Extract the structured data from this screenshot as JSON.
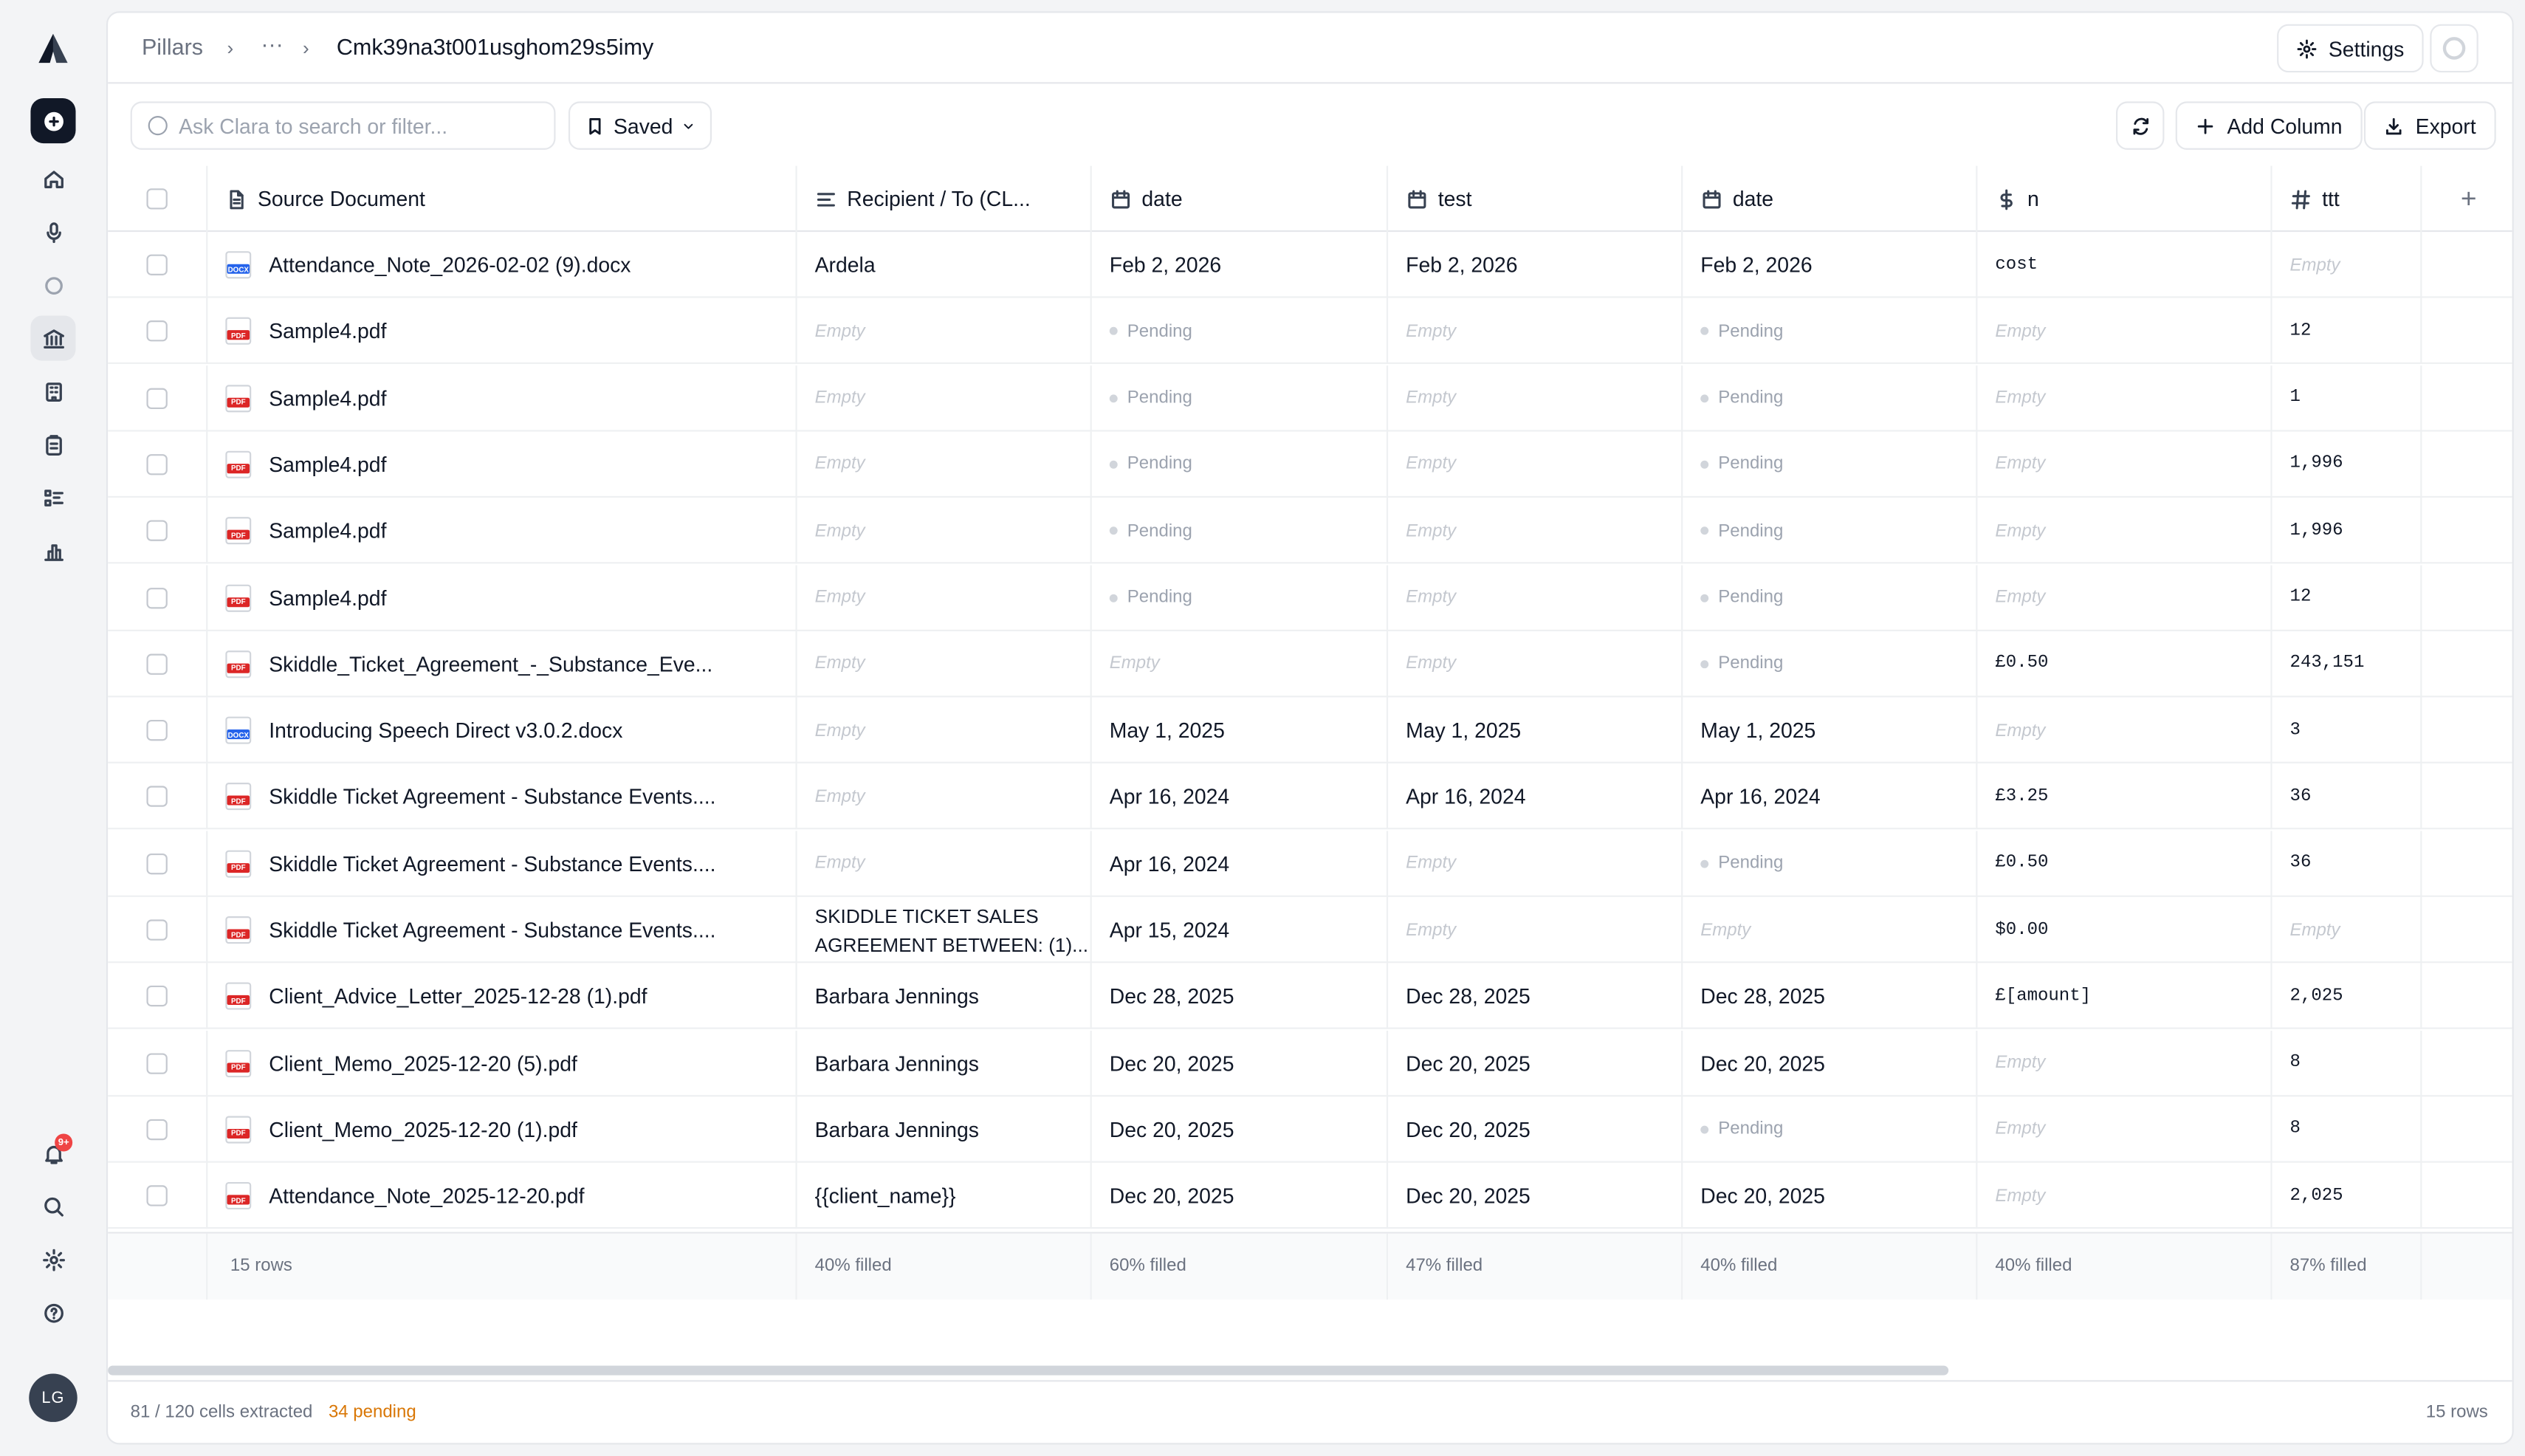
{
  "breadcrumb": {
    "root": "Pillars",
    "ellipsis": "···",
    "current": "Cmk39na3t001usghom29s5imy"
  },
  "header": {
    "settings_label": "Settings"
  },
  "toolbar": {
    "search_placeholder": "Ask Clara to search or filter...",
    "saved_label": "Saved",
    "add_column_label": "Add Column",
    "export_label": "Export"
  },
  "notifications": {
    "badge": "9+"
  },
  "user": {
    "initials": "LG"
  },
  "columns": [
    {
      "label": "Source Document",
      "icon": "document-icon"
    },
    {
      "label": "Recipient / To (CL...",
      "icon": "text-icon"
    },
    {
      "label": "date",
      "icon": "calendar-icon"
    },
    {
      "label": "test",
      "icon": "calendar-icon"
    },
    {
      "label": "date",
      "icon": "calendar-icon"
    },
    {
      "label": "n",
      "icon": "dollar-icon"
    },
    {
      "label": "ttt",
      "icon": "hash-icon"
    }
  ],
  "rows": [
    {
      "doc": "Attendance_Note_2026-02-02 (9).docx",
      "type": "docx",
      "recipient": "Ardela",
      "date1": "Feb 2, 2026",
      "test": "Feb 2, 2026",
      "date2": "Feb 2, 2026",
      "n": "cost",
      "ttt": "Empty"
    },
    {
      "doc": "Sample4.pdf",
      "type": "pdf",
      "recipient": "Empty",
      "date1": "Pending",
      "test": "Empty",
      "date2": "Pending",
      "n": "Empty",
      "ttt": "12"
    },
    {
      "doc": "Sample4.pdf",
      "type": "pdf",
      "recipient": "Empty",
      "date1": "Pending",
      "test": "Empty",
      "date2": "Pending",
      "n": "Empty",
      "ttt": "1"
    },
    {
      "doc": "Sample4.pdf",
      "type": "pdf",
      "recipient": "Empty",
      "date1": "Pending",
      "test": "Empty",
      "date2": "Pending",
      "n": "Empty",
      "ttt": "1,996"
    },
    {
      "doc": "Sample4.pdf",
      "type": "pdf",
      "recipient": "Empty",
      "date1": "Pending",
      "test": "Empty",
      "date2": "Pending",
      "n": "Empty",
      "ttt": "1,996"
    },
    {
      "doc": "Sample4.pdf",
      "type": "pdf",
      "recipient": "Empty",
      "date1": "Pending",
      "test": "Empty",
      "date2": "Pending",
      "n": "Empty",
      "ttt": "12"
    },
    {
      "doc": "Skiddle_Ticket_Agreement_-_Substance_Eve...",
      "type": "pdf",
      "recipient": "Empty",
      "date1": "Empty",
      "test": "Empty",
      "date2": "Pending",
      "n": "£0.50",
      "ttt": "243,151"
    },
    {
      "doc": "Introducing Speech Direct v3.0.2.docx",
      "type": "docx",
      "recipient": "Empty",
      "date1": "May 1, 2025",
      "test": "May 1, 2025",
      "date2": "May 1, 2025",
      "n": "Empty",
      "ttt": "3"
    },
    {
      "doc": "Skiddle Ticket Agreement - Substance Events....",
      "type": "pdf",
      "recipient": "Empty",
      "date1": "Apr 16, 2024",
      "test": "Apr 16, 2024",
      "date2": "Apr 16, 2024",
      "n": "£3.25",
      "ttt": "36"
    },
    {
      "doc": "Skiddle Ticket Agreement - Substance Events....",
      "type": "pdf",
      "recipient": "Empty",
      "date1": "Apr 16, 2024",
      "test": "Empty",
      "date2": "Pending",
      "n": "£0.50",
      "ttt": "36"
    },
    {
      "doc": "Skiddle Ticket Agreement - Substance Events....",
      "type": "pdf",
      "recipient": "SKIDDLE TICKET SALES AGREEMENT BETWEEN: (1)...",
      "date1": "Apr 15, 2024",
      "test": "Empty",
      "date2": "Empty",
      "n": "$0.00",
      "ttt": "Empty"
    },
    {
      "doc": "Client_Advice_Letter_2025-12-28 (1).pdf",
      "type": "pdf",
      "recipient": "Barbara Jennings",
      "date1": "Dec 28, 2025",
      "test": "Dec 28, 2025",
      "date2": "Dec 28, 2025",
      "n": "£[amount]",
      "ttt": "2,025"
    },
    {
      "doc": "Client_Memo_2025-12-20 (5).pdf",
      "type": "pdf",
      "recipient": "Barbara Jennings",
      "date1": "Dec 20, 2025",
      "test": "Dec 20, 2025",
      "date2": "Dec 20, 2025",
      "n": "Empty",
      "ttt": "8"
    },
    {
      "doc": "Client_Memo_2025-12-20 (1).pdf",
      "type": "pdf",
      "recipient": "Barbara Jennings",
      "date1": "Dec 20, 2025",
      "test": "Dec 20, 2025",
      "date2": "Pending",
      "n": "Empty",
      "ttt": "8"
    },
    {
      "doc": "Attendance_Note_2025-12-20.pdf",
      "type": "pdf",
      "recipient": "{{client_name}}",
      "date1": "Dec 20, 2025",
      "test": "Dec 20, 2025",
      "date2": "Dec 20, 2025",
      "n": "Empty",
      "ttt": "2,025"
    }
  ],
  "summary": {
    "rows": "15 rows",
    "recipient": "40% filled",
    "date1": "60% filled",
    "test": "47% filled",
    "date2": "40% filled",
    "n": "40% filled",
    "ttt": "87% filled"
  },
  "status_bar": {
    "extracted": "81 / 120 cells extracted",
    "pending": "34 pending",
    "row_count": "15 rows"
  }
}
